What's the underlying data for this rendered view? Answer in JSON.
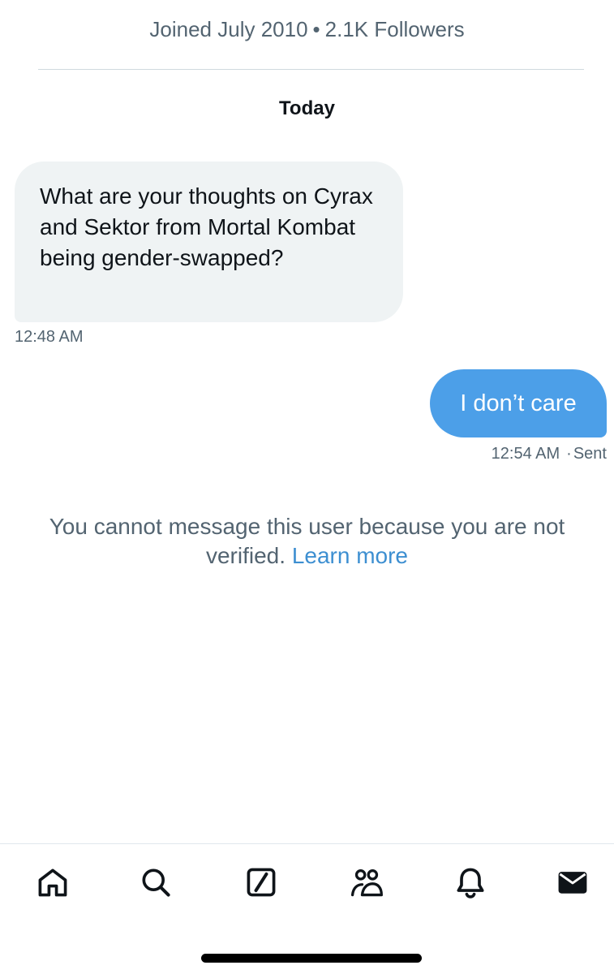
{
  "profile": {
    "joined": "Joined July 2010",
    "separator": "•",
    "followers": "2.1K Followers"
  },
  "conversation": {
    "day_label": "Today",
    "messages": [
      {
        "direction": "incoming",
        "text": "What are your thoughts on Cyrax and Sektor from Mortal Kombat being gender-swapped?",
        "time": "12:48 AM"
      },
      {
        "direction": "outgoing",
        "text": "I don’t care",
        "time": "12:54 AM",
        "status_separator": "·",
        "status": "Sent"
      }
    ],
    "notice": {
      "text": "You cannot message this user because you are not verified.",
      "link": "Learn more"
    }
  },
  "tabbar": {
    "items": [
      {
        "icon": "home-icon",
        "active": false
      },
      {
        "icon": "search-icon",
        "active": false
      },
      {
        "icon": "grok-icon",
        "active": false
      },
      {
        "icon": "communities-icon",
        "active": false
      },
      {
        "icon": "bell-icon",
        "active": false
      },
      {
        "icon": "envelope-icon",
        "active": true
      }
    ]
  },
  "colors": {
    "outgoing_bubble": "#4c9fe8",
    "incoming_bubble": "#eff3f4",
    "link": "#3d8fd1",
    "secondary_text": "#536471"
  }
}
